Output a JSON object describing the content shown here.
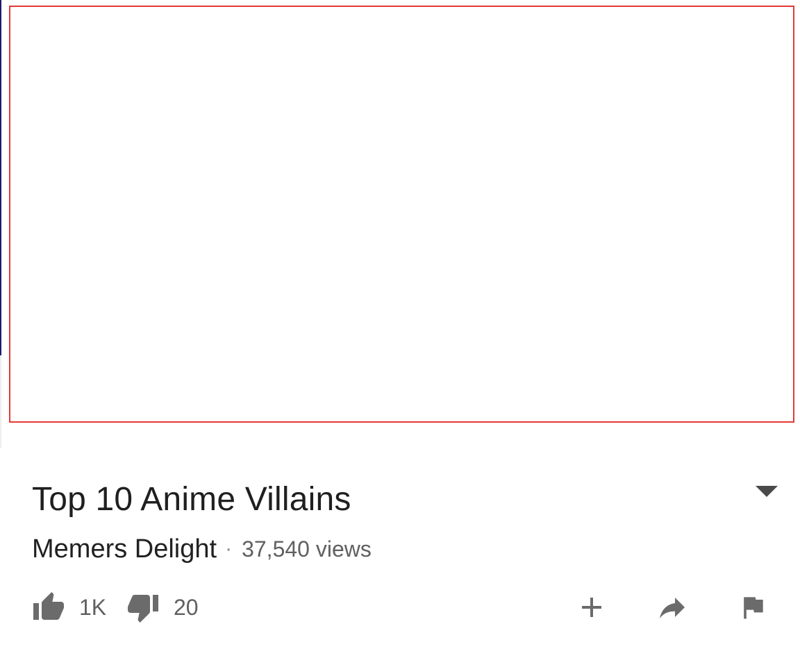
{
  "video": {
    "title": "Top 10 Anime Villains",
    "channel": "Memers Delight",
    "separator": "·",
    "views": "37,540 views"
  },
  "actions": {
    "like_count": "1K",
    "dislike_count": "20"
  },
  "icons": {
    "expand": "chevron-down-icon",
    "like": "thumbs-up-icon",
    "dislike": "thumbs-down-icon",
    "add": "plus-icon",
    "share": "share-arrow-icon",
    "report": "flag-icon"
  },
  "colors": {
    "player_border": "#e53935",
    "icon_gray": "#6b6b6b",
    "title_text": "#1f1f1f",
    "secondary_text": "#606060"
  }
}
